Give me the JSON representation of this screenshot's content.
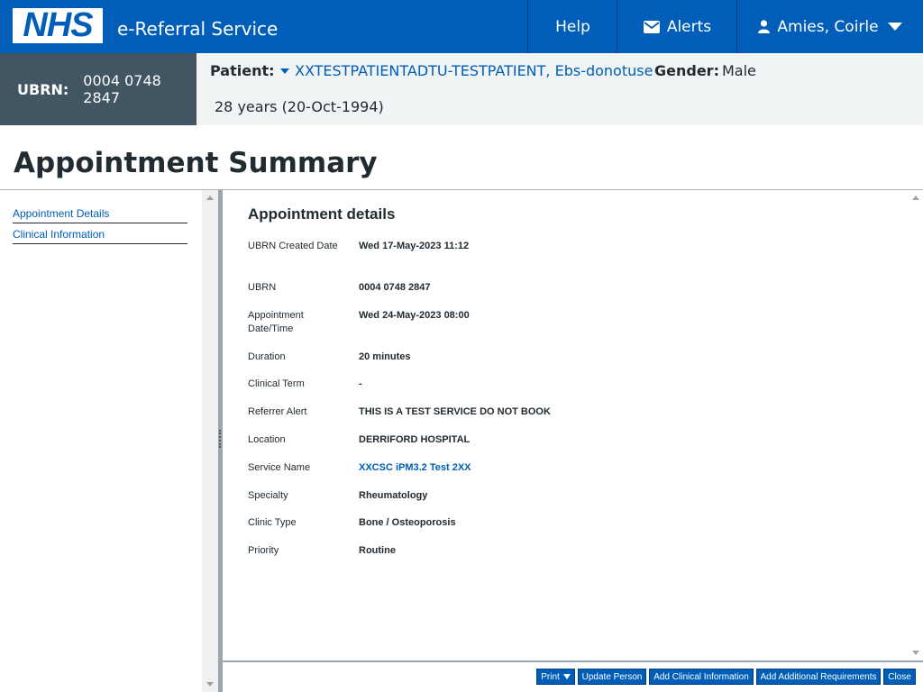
{
  "header": {
    "logo_text": "NHS",
    "service_name": "e-Referral Service",
    "help_label": "Help",
    "alerts_label": "Alerts",
    "user_label": "Amies, Coirle"
  },
  "banner": {
    "ubrn_label": "UBRN:",
    "ubrn_value": "0004 0748 2847",
    "patient_label": "Patient:",
    "patient_name": "XXTESTPATIENTADTU-TESTPATIENT, Ebs-donotuse",
    "gender_label": "Gender:",
    "gender_value": "Male",
    "age": "28 years (20-Oct-1994)"
  },
  "page_title": "Appointment Summary",
  "left_nav": [
    {
      "label": "Appointment Details"
    },
    {
      "label": "Clinical Information"
    }
  ],
  "details": {
    "title": "Appointment details",
    "rows": [
      {
        "label": "UBRN Created Date",
        "value": "Wed 17-May-2023 11:12"
      },
      {
        "label": "UBRN",
        "value": "0004 0748 2847"
      },
      {
        "label": "Appointment Date/Time",
        "value": "Wed 24-May-2023 08:00"
      },
      {
        "label": "Duration",
        "value": "20 minutes"
      },
      {
        "label": "Clinical Term",
        "value": "-"
      },
      {
        "label": "Referrer Alert",
        "value": "THIS IS A TEST SERVICE DO NOT BOOK"
      },
      {
        "label": "Location",
        "value": "DERRIFORD HOSPITAL"
      },
      {
        "label": "Service Name",
        "value": "XXCSC iPM3.2 Test 2XX"
      },
      {
        "label": "Specialty",
        "value": "Rheumatology"
      },
      {
        "label": "Clinic Type",
        "value": "Bone / Osteoporosis"
      },
      {
        "label": "Priority",
        "value": "Routine"
      }
    ]
  },
  "buttons": {
    "print": "Print",
    "update_person": "Update Person",
    "add_clinical": "Add Clinical Information",
    "add_requirements": "Add Additional Requirements",
    "close": "Close"
  },
  "colors": {
    "nhs_blue": "#005eb8",
    "banner_dark": "#425563",
    "banner_light": "#f0f4f5"
  }
}
